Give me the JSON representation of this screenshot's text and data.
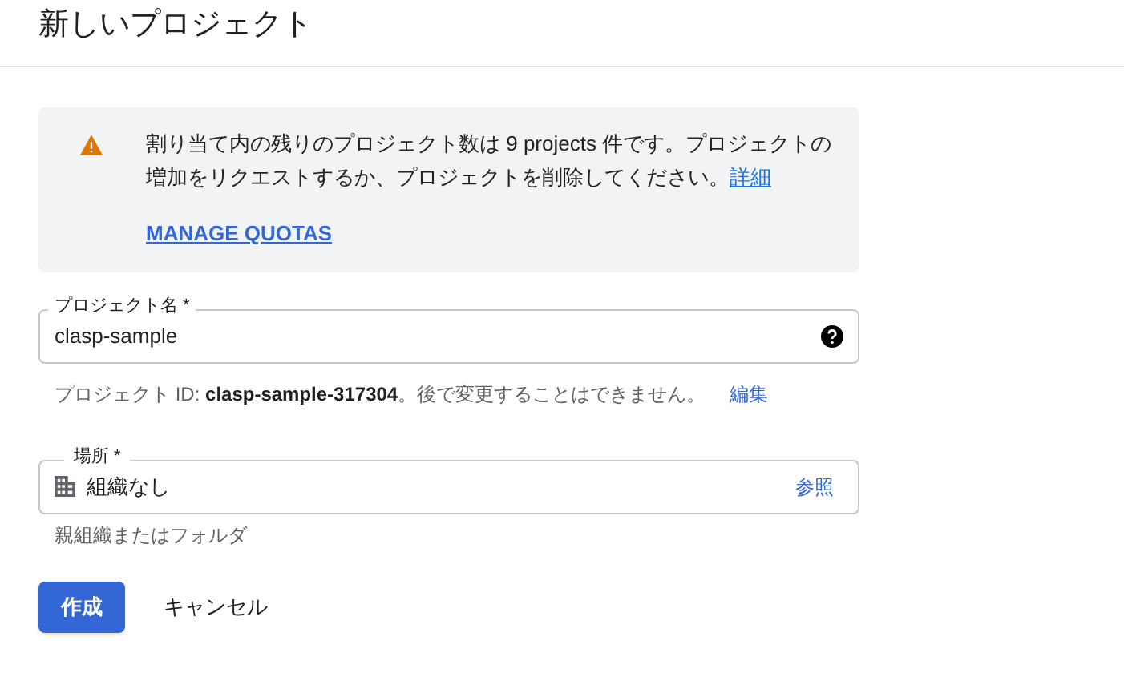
{
  "header": {
    "title": "新しいプロジェクト"
  },
  "notice": {
    "text": "割り当て内の残りのプロジェクト数は 9 projects 件です。プロジェクトの増加をリクエストするか、プロジェクトを削除してください。",
    "link": "詳細",
    "action": "MANAGE QUOTAS"
  },
  "project_name": {
    "label": "プロジェクト名 *",
    "value": "clasp-sample",
    "hint": "プロジェクト ID: **clasp-sample-317304**。後で変更することはできません。",
    "hint_link": "編集"
  },
  "location": {
    "label": "場所 *",
    "value": "組織なし",
    "browse": "参照",
    "hint": "親組織またはフォルダ"
  },
  "buttons": [
    {
      "label": "作成",
      "kind": "primary"
    },
    {
      "label": "キャンセル",
      "kind": "text"
    }
  ]
}
